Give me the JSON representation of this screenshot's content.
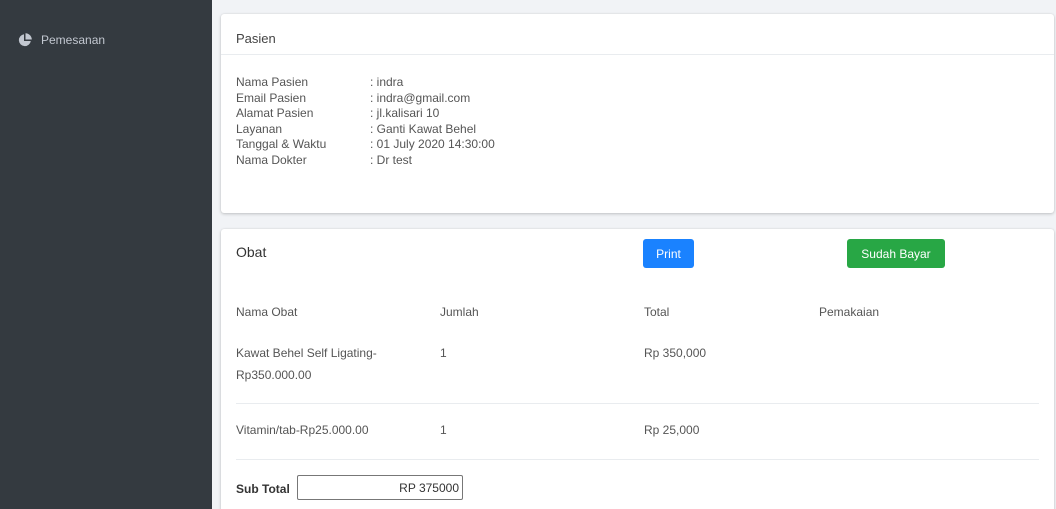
{
  "sidebar": {
    "items": [
      {
        "label": "Pemesanan",
        "icon": "chart-pie-icon"
      }
    ]
  },
  "pasien": {
    "header": "Pasien",
    "rows": [
      {
        "label": "Nama Pasien",
        "value": ": indra"
      },
      {
        "label": "Email Pasien",
        "value": ": indra@gmail.com"
      },
      {
        "label": "Alamat Pasien",
        "value": ": jl.kalisari 10"
      },
      {
        "label": "Layanan",
        "value": ": Ganti Kawat Behel"
      },
      {
        "label": "Tanggal & Waktu",
        "value": ": 01 July 2020 14:30:00"
      },
      {
        "label": "Nama Dokter",
        "value": ": Dr test"
      }
    ]
  },
  "obat": {
    "title": "Obat",
    "print_label": "Print",
    "bayar_label": "Sudah Bayar",
    "columns": [
      "Nama Obat",
      "Jumlah",
      "Total",
      "Pemakaian"
    ],
    "rows": [
      {
        "nama_line1": "Kawat Behel Self Ligating-",
        "nama_line2": "Rp350.000.00",
        "jumlah": "1",
        "total": "Rp 350,000",
        "pemakaian": ""
      },
      {
        "nama_line1": "Vitamin/tab-Rp25.000.00",
        "nama_line2": "",
        "jumlah": "1",
        "total": "Rp 25,000",
        "pemakaian": ""
      }
    ],
    "subtotal_label": "Sub Total",
    "subtotal_value": "RP 375000"
  },
  "colors": {
    "sidebar_bg": "#343a40",
    "print_button": "#1a82ff",
    "bayar_button": "#28a745"
  }
}
